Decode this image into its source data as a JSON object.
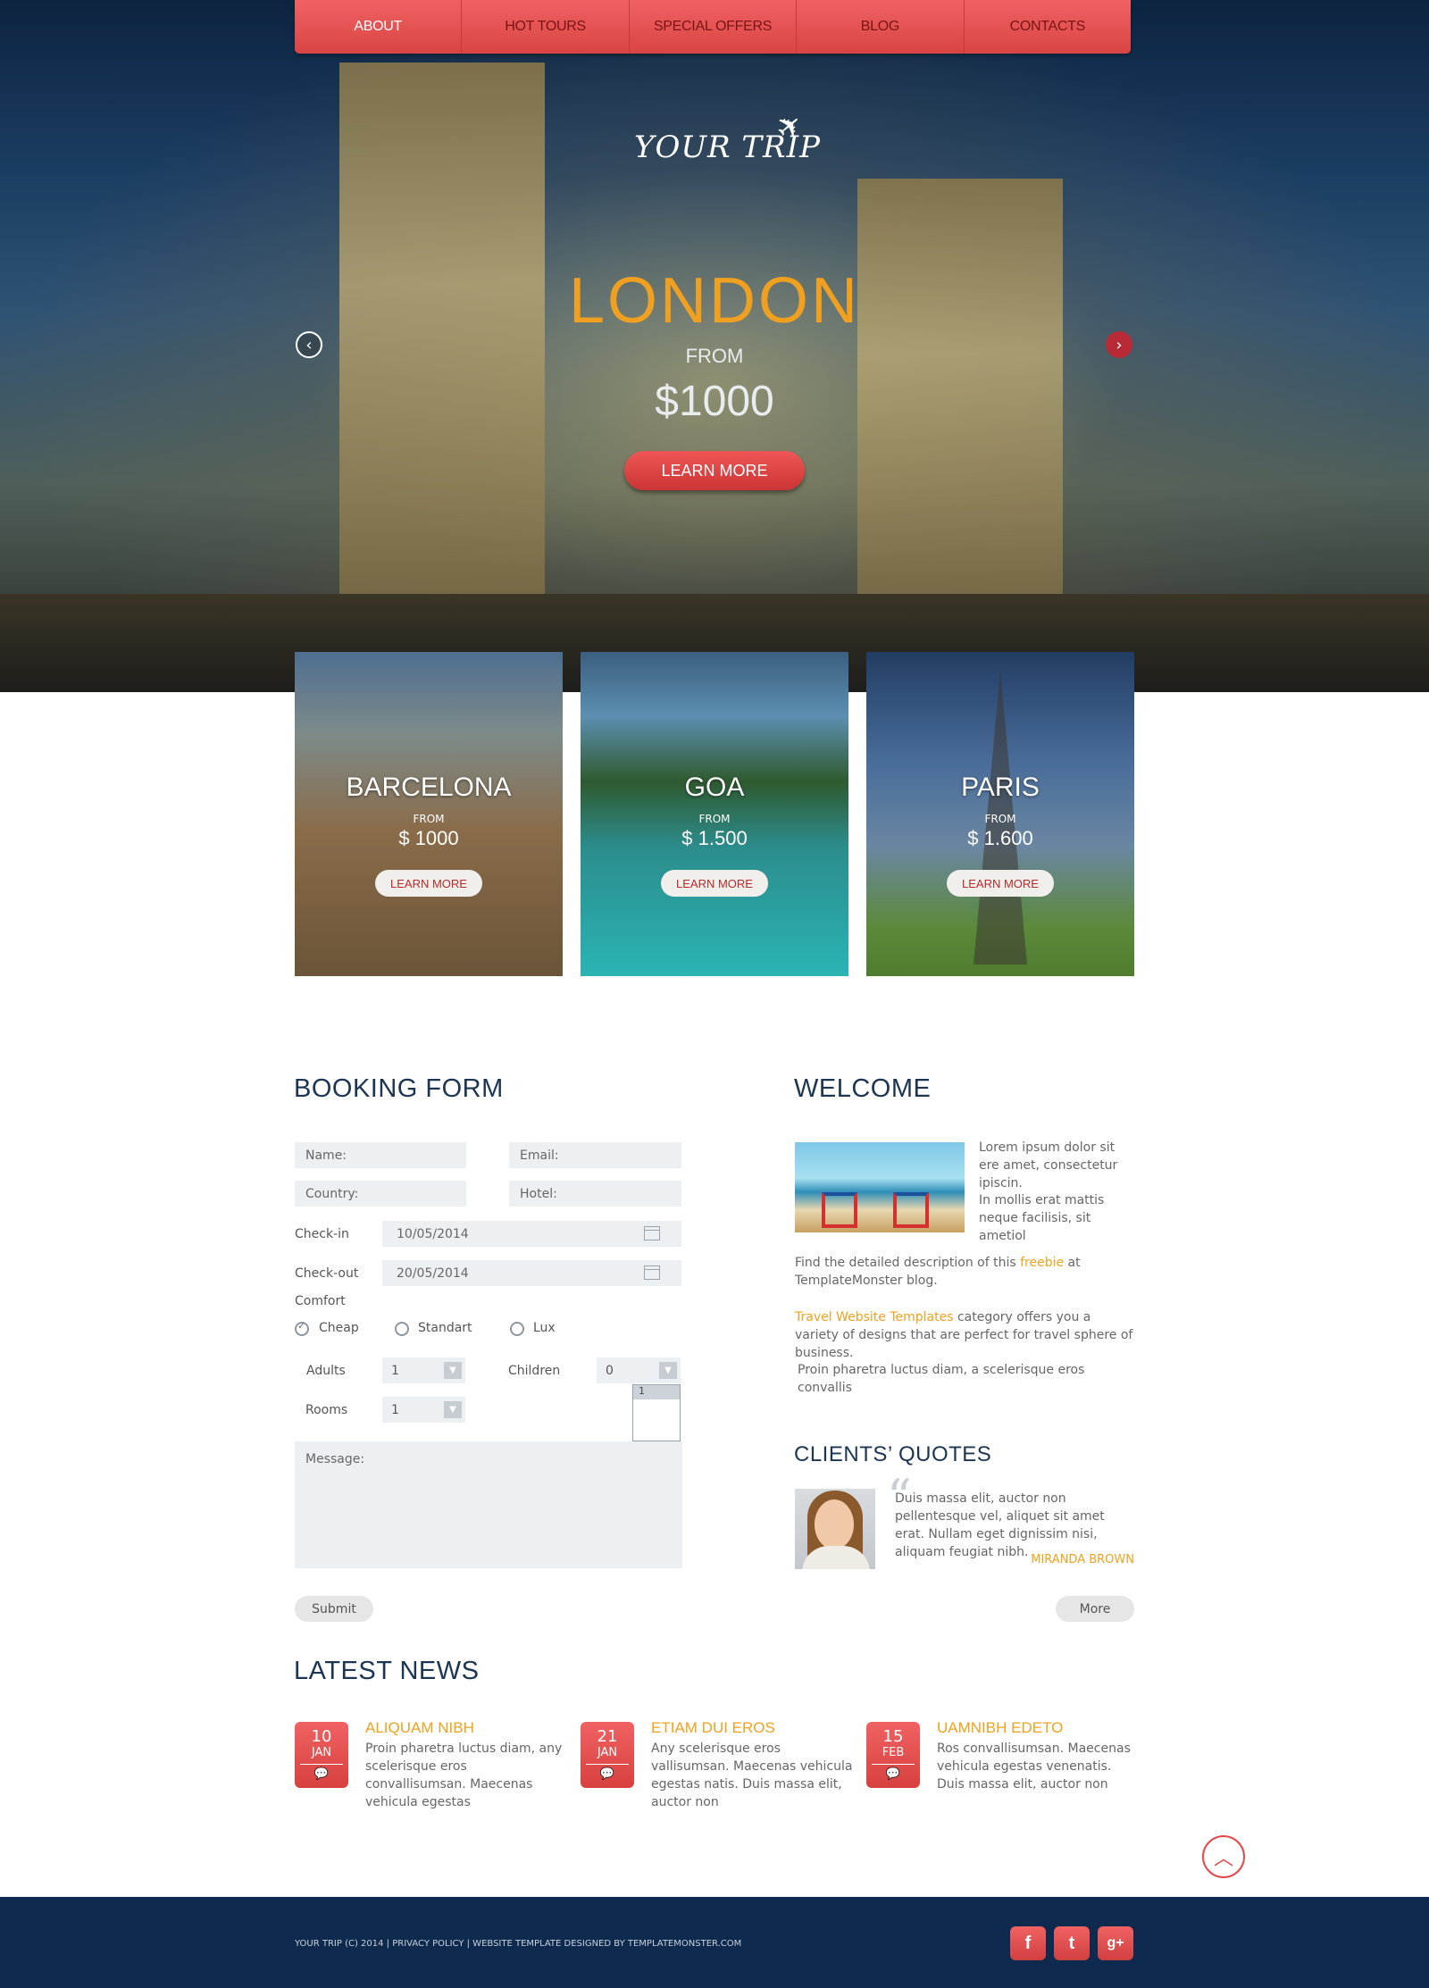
{
  "nav": {
    "items": [
      {
        "label": "ABOUT"
      },
      {
        "label": "HOT TOURS"
      },
      {
        "label": "SPECIAL OFFERS"
      },
      {
        "label": "BLOG"
      },
      {
        "label": "CONTACTS"
      }
    ]
  },
  "hero": {
    "logo": "YOUR TRIP",
    "city": "LONDON",
    "from": "FROM",
    "price": "$1000",
    "button": "LEARN MORE",
    "prev_icon": "chevron-left-icon",
    "next_icon": "chevron-right-icon"
  },
  "cards": [
    {
      "title": "BARCELONA",
      "from": "FROM",
      "price": "$ 1000",
      "button": "LEARN MORE"
    },
    {
      "title": "GOA",
      "from": "FROM",
      "price": "$ 1.500",
      "button": "LEARN MORE"
    },
    {
      "title": "PARIS",
      "from": "FROM",
      "price": "$ 1.600",
      "button": "LEARN MORE"
    }
  ],
  "booking": {
    "heading": "BOOKING FORM",
    "name_placeholder": "Name:",
    "email_placeholder": "Email:",
    "country_placeholder": "Country:",
    "hotel_placeholder": "Hotel:",
    "checkin_label": "Check-in",
    "checkin_value": "10/05/2014",
    "checkout_label": "Check-out",
    "checkout_value": "20/05/2014",
    "comfort_label": "Comfort",
    "comfort_options": [
      {
        "label": "Cheap",
        "checked": true
      },
      {
        "label": "Standart",
        "checked": false
      },
      {
        "label": "Lux",
        "checked": false
      }
    ],
    "adults_label": "Adults",
    "adults_value": "1",
    "children_label": "Children",
    "children_value": "0",
    "children_dropdown_option": "1",
    "rooms_label": "Rooms",
    "rooms_value": "1",
    "message_placeholder": "Message:",
    "submit": "Submit"
  },
  "welcome": {
    "heading": "WELCOME",
    "p1": "Lorem ipsum dolor sit ere amet, consectetur ipiscin.",
    "p2": "In mollis erat mattis neque facilisis, sit ametiol",
    "p3_before": "Find the detailed description of this ",
    "p3_link": "freebie",
    "p3_after": " at TemplateMonster blog.",
    "p4_link": "Travel Website Templates",
    "p4_after": " category offers you a variety of designs that are perfect for travel sphere of business.",
    "p5": "Proin pharetra luctus diam, a scelerisque eros convallis"
  },
  "quotes": {
    "heading": "CLIENTS’ QUOTES",
    "text": "Duis massa elit, auctor non pellentesque vel, aliquet sit amet erat. Nullam eget dignissim nisi, aliquam feugiat nibh.",
    "author": "MIRANDA BROWN",
    "more": "More"
  },
  "news": {
    "heading": "LATEST NEWS",
    "items": [
      {
        "day": "10",
        "month": "JAN",
        "title": "ALIQUAM NIBH",
        "text": "Proin pharetra luctus diam, any scelerisque eros convallisumsan. Maecenas vehicula egestas"
      },
      {
        "day": "21",
        "month": "JAN",
        "title": "ETIAM DUI EROS",
        "text": "Any scelerisque eros vallisumsan. Maecenas vehicula egestas natis. Duis massa elit, auctor non"
      },
      {
        "day": "15",
        "month": "FEB",
        "title": "UAMNIBH EDETO",
        "text": "Ros convallisumsan. Maecenas vehicula egestas venenatis. Duis massa elit, auctor non"
      }
    ]
  },
  "footer": {
    "text": "YOUR TRIP (C) 2014  |  PRIVACY POLICY | WEBSITE TEMPLATE DESIGNED BY TEMPLATEMONSTER.COM",
    "social": [
      "f",
      "t",
      "g+"
    ]
  },
  "colors": {
    "accent_red": "#e04848",
    "accent_orange": "#efa21e",
    "navy": "#0e2a4e",
    "heading": "#1c3552"
  }
}
